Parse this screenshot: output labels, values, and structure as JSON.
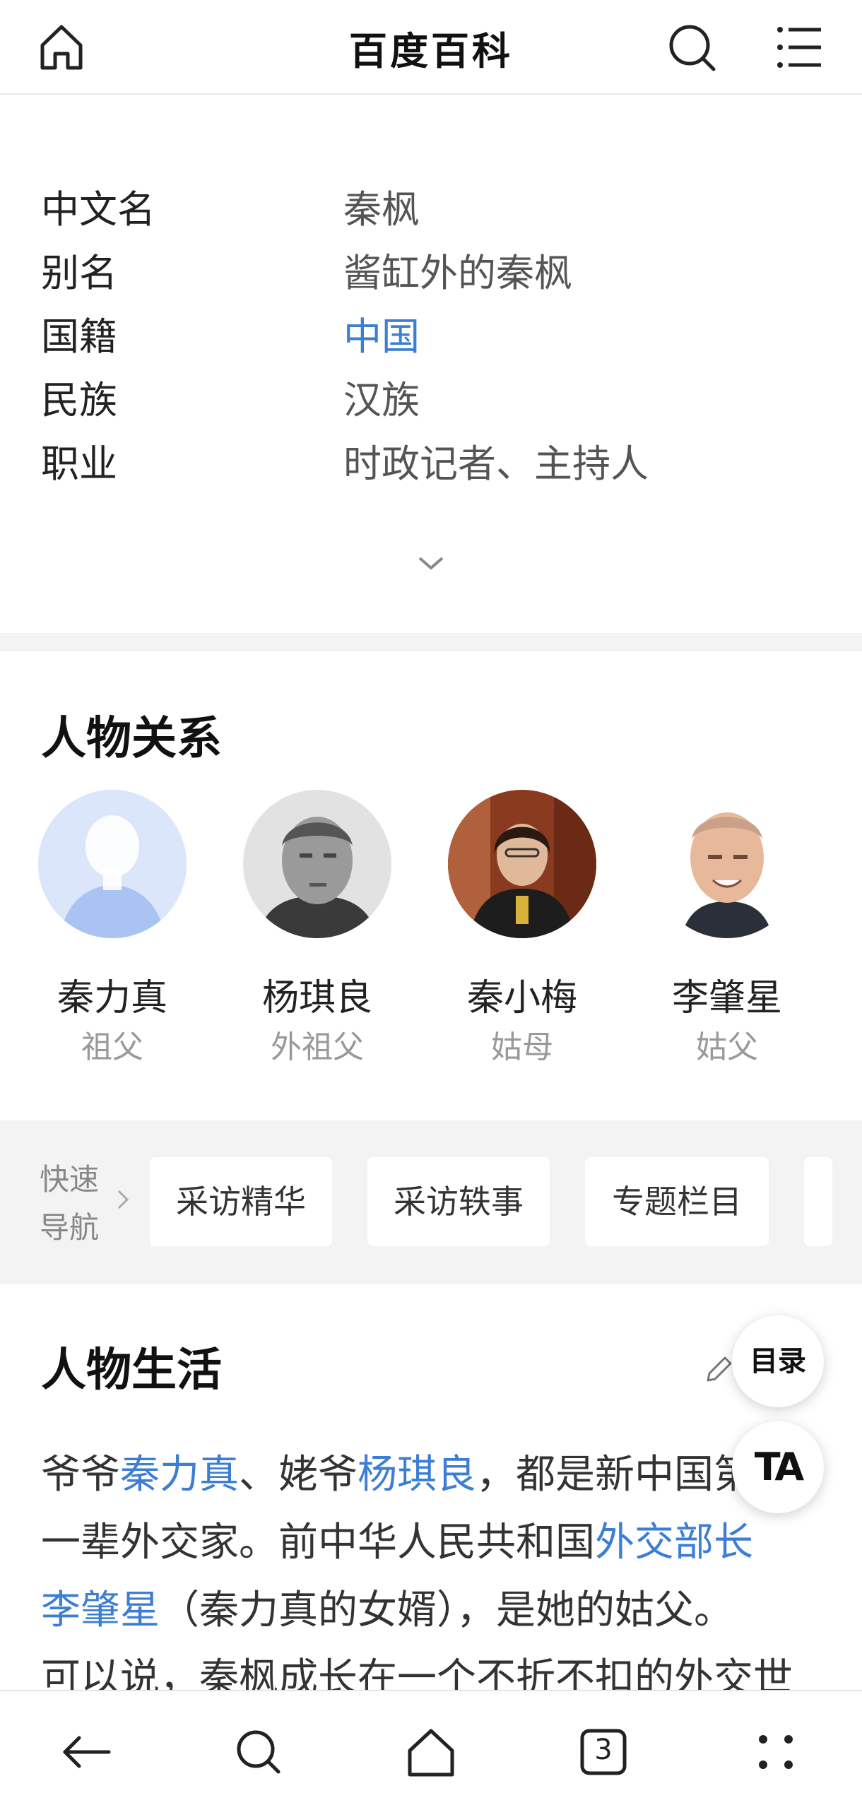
{
  "header": {
    "title": "百度百科",
    "icons": {
      "home": "home-icon",
      "search": "search-icon",
      "menu": "menu-icon"
    }
  },
  "info": {
    "rows": [
      {
        "key": "中文名",
        "value": "秦枫",
        "is_link": false
      },
      {
        "key": "别名",
        "value": "酱缸外的秦枫",
        "is_link": false
      },
      {
        "key": "国籍",
        "value": "中国",
        "is_link": true
      },
      {
        "key": "民族",
        "value": "汉族",
        "is_link": false
      },
      {
        "key": "职业",
        "value": "时政记者、主持人",
        "is_link": false
      }
    ],
    "expand_icon": "chevron-down-icon"
  },
  "relations": {
    "title": "人物关系",
    "people": [
      {
        "name": "秦力真",
        "relation": "祖父",
        "avatar": "default-avatar"
      },
      {
        "name": "杨琪良",
        "relation": "外祖父",
        "avatar": "photo"
      },
      {
        "name": "秦小梅",
        "relation": "姑母",
        "avatar": "photo"
      },
      {
        "name": "李肇星",
        "relation": "姑父",
        "avatar": "photo"
      }
    ]
  },
  "quick_nav": {
    "label_line1": "快速",
    "label_line2": "导航",
    "buttons": [
      "采访精华",
      "采访轶事",
      "专题栏目"
    ]
  },
  "life": {
    "title": "人物生活",
    "para": {
      "l1_a": "爷爷",
      "l1_link1": "秦力真",
      "l1_b": "、姥爷",
      "l1_link2": "杨琪良",
      "l1_c": "，都是新中国第",
      "l2_a": "一辈外交家。前中华人民共和国",
      "l2_link": "外交部长",
      "l3_link": "李肇星",
      "l3_a": "（秦力真的女婿），是她的姑父。",
      "l4_a": "可以说，秦枫成长在一个不折不扣的外交世"
    }
  },
  "floating": {
    "toc": "目录",
    "ta": "TA"
  },
  "bottom_bar": {
    "tab_count": "3",
    "icons": [
      "back-arrow-icon",
      "search-icon",
      "home-icon",
      "tabs-icon",
      "more-icon"
    ]
  }
}
